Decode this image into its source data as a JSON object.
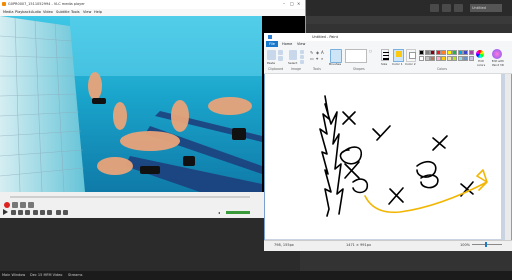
{
  "vlc": {
    "title": "G0PR0007_1511052994 - VLC media player",
    "menu": [
      "Media",
      "Playback",
      "Audio",
      "Video",
      "Subtitle",
      "Tools",
      "View",
      "Help"
    ],
    "time_elapsed": "",
    "time_total": ""
  },
  "dark_app": {
    "tab_label": "Untitled",
    "tab2_label": ""
  },
  "paint": {
    "title": "Untitled - Paint",
    "tabs": [
      "File",
      "Home",
      "View"
    ],
    "groups": [
      "Clipboard",
      "Image",
      "Tools",
      "Shapes",
      "Colors"
    ],
    "paste_label": "Paste",
    "select_label": "Select",
    "brushes_label": "Brushes",
    "size_label": "Size",
    "color1_label": "Color 1",
    "color2_label": "Color 2",
    "edit_colors_label": "Edit colors",
    "edit_paint3d_label": "Edit with Paint 3D",
    "status_pos": "798, 155px",
    "status_size": "1471 × 991px",
    "zoom": "100%",
    "palette": [
      "#000000",
      "#7f7f7f",
      "#880015",
      "#ed1c24",
      "#ff7f27",
      "#fff200",
      "#22b14c",
      "#00a2e8",
      "#3f48cc",
      "#a349a4",
      "#ffffff",
      "#c3c3c3",
      "#b97a57",
      "#ffaec9",
      "#ffc90e",
      "#efe4b0",
      "#b5e61d",
      "#99d9ea",
      "#7092be",
      "#c8bfe7"
    ],
    "color1": "#ffc90e",
    "color2": "#ffffff"
  },
  "taskbar": {
    "item1": "Main Window",
    "item2": "Dec 15 MFM Video",
    "item3": "Streams"
  }
}
